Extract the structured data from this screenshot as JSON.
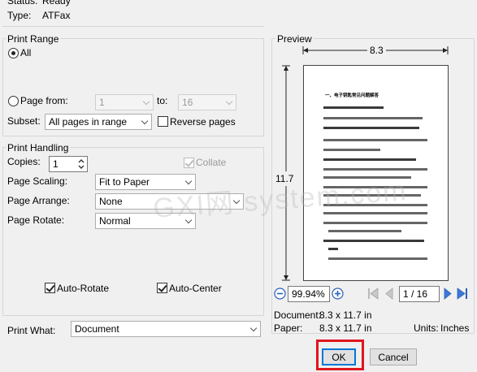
{
  "status": {
    "label": "Status:",
    "value": "Ready"
  },
  "type": {
    "label": "Type:",
    "value": "ATFax"
  },
  "print_range": {
    "title": "Print Range",
    "all_label": "All",
    "page_from_label": "Page from:",
    "from_value": "1",
    "to_label": "to:",
    "to_value": "16",
    "subset_label": "Subset:",
    "subset_value": "All pages in range",
    "reverse_label": "Reverse pages"
  },
  "print_handling": {
    "title": "Print Handling",
    "copies_label": "Copies:",
    "copies_value": "1",
    "collate_label": "Collate",
    "scaling_label": "Page Scaling:",
    "scaling_value": "Fit to Paper",
    "arrange_label": "Page Arrange:",
    "arrange_value": "None",
    "rotate_label": "Page Rotate:",
    "rotate_value": "Normal",
    "auto_rotate_label": "Auto-Rotate",
    "auto_center_label": "Auto-Center"
  },
  "print_what": {
    "label": "Print What:",
    "value": "Document"
  },
  "preview": {
    "title": "Preview",
    "width_label": "8.3",
    "height_label": "11.7",
    "zoom": "99.94%",
    "page_indicator": "1 / 16",
    "document_label": "Document:",
    "document_value": "8.3 x 11.7 in",
    "paper_label": "Paper:",
    "paper_value": "8.3 x 11.7 in",
    "units_label": "Units:",
    "units_value": "Inches",
    "watermark": "GXI网 system.com",
    "page_heading": "一、电子钥匙常见问题解答"
  },
  "buttons": {
    "ok": "OK",
    "cancel": "Cancel"
  },
  "colors": {
    "highlight": "#e0161e",
    "group_border": "#d5d5d5",
    "background": "#f0f0f0"
  }
}
